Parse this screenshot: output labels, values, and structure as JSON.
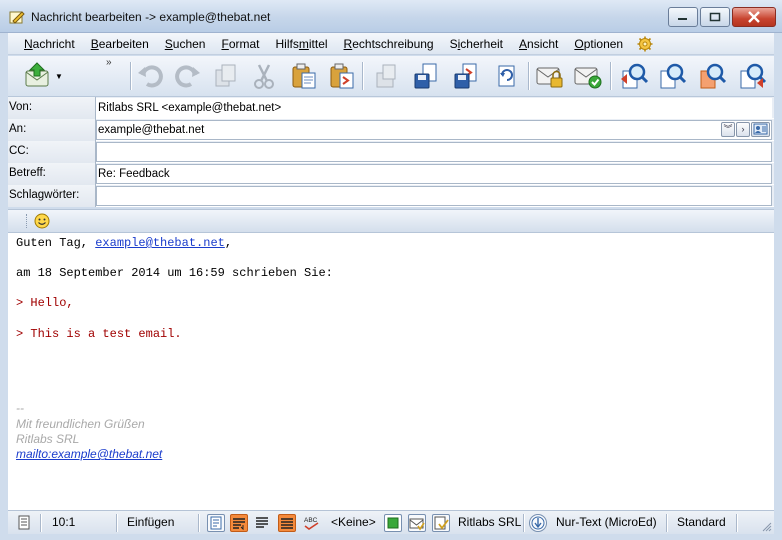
{
  "window": {
    "title": "Nachricht bearbeiten -> example@thebat.net"
  },
  "menu": [
    {
      "pre": "",
      "u": "N",
      "post": "achricht"
    },
    {
      "pre": "",
      "u": "B",
      "post": "earbeiten"
    },
    {
      "pre": "",
      "u": "S",
      "post": "uchen"
    },
    {
      "pre": "",
      "u": "F",
      "post": "ormat"
    },
    {
      "pre": "Hilfs",
      "u": "m",
      "post": "ittel"
    },
    {
      "pre": "",
      "u": "R",
      "post": "echtschreibung"
    },
    {
      "pre": "S",
      "u": "i",
      "post": "cherheit"
    },
    {
      "pre": "",
      "u": "A",
      "post": "nsicht"
    },
    {
      "pre": "",
      "u": "O",
      "post": "ptionen"
    }
  ],
  "toolbar": {
    "overflow": "»",
    "icons": [
      "send-icon",
      "undo-icon",
      "redo-icon",
      "copy-icon",
      "cut-icon",
      "paste-icon",
      "paste-quote-icon",
      "save-template-icon",
      "save-icon",
      "save-as-icon",
      "refresh-icon",
      "encrypt-icon",
      "check-spelling-icon",
      "find-icon",
      "find-next-icon",
      "replace-icon",
      "find-prev-icon"
    ]
  },
  "headers": {
    "from_label": "Von:",
    "from_value": "Ritlabs SRL <example@thebat.net>",
    "to_label": "An:",
    "to_value": "example@thebat.net",
    "cc_label": "CC:",
    "cc_value": "",
    "subject_label": "Betreff:",
    "subject_value": "Re: Feedback",
    "keywords_label": "Schlagwörter:",
    "keywords_value": ""
  },
  "body": {
    "greeting_prefix": "Guten Tag, ",
    "greeting_email": "example@thebat.net",
    "greeting_suffix": ",",
    "wrote_line": "am 18 September 2014 um 16:59 schrieben Sie:",
    "quote1": "> Hello,",
    "quote2": "> This is a test email.",
    "sig_dash": "--",
    "sig_line1": "Mit freundlichen Grüßen",
    "sig_line2": "Ritlabs SRL",
    "sig_link": "mailto:example@thebat.net"
  },
  "status": {
    "position": "10:1",
    "mode": "Einfügen",
    "template": "<Keine>",
    "account": "Ritlabs SRL",
    "format": "Nur-Text (MicroEd)",
    "charset": "Standard"
  },
  "colors": {
    "quote": "#a00000",
    "link": "#1a3ccc",
    "signature": "#a9a9a9",
    "active_format": "#f48a3c"
  }
}
